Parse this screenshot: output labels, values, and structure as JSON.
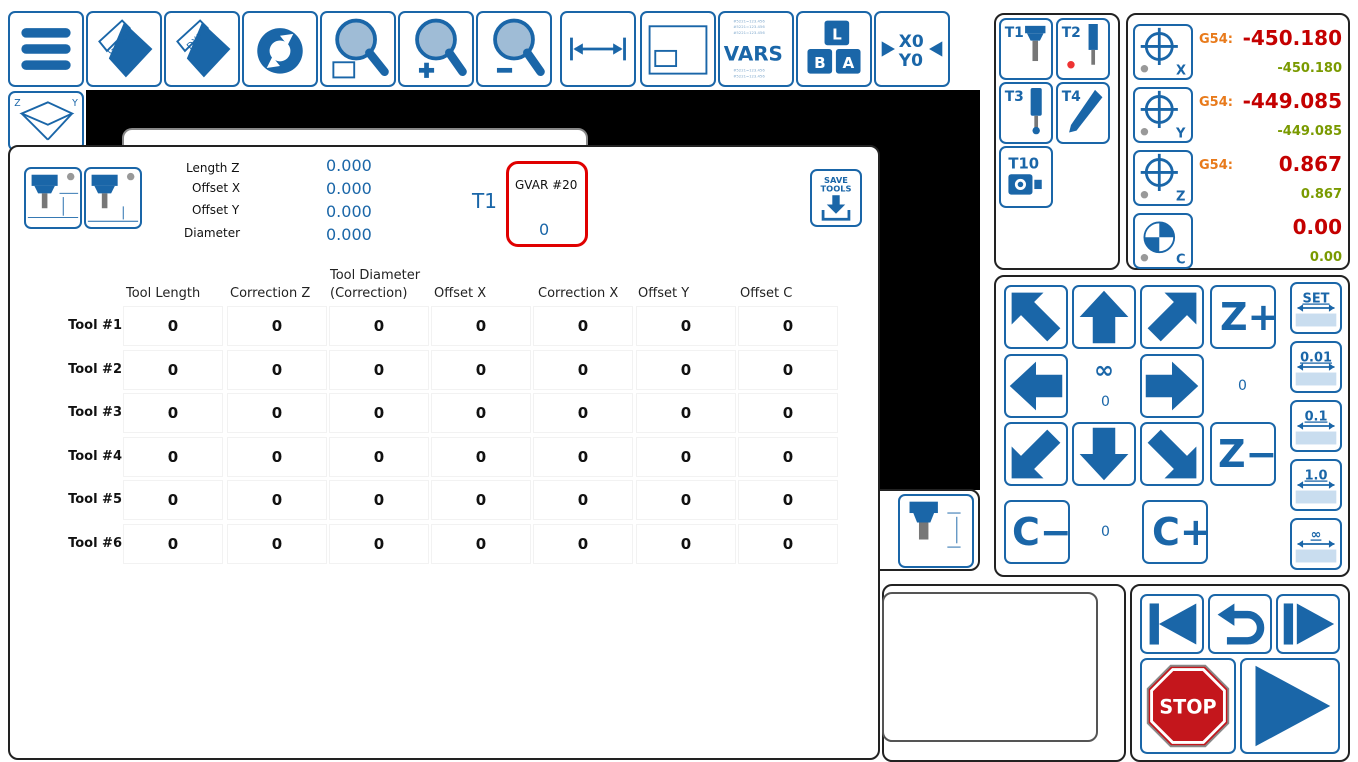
{
  "toolbar": {
    "gcode_label": "G-code",
    "dxf_label": "DXF",
    "vars_label": "VARS",
    "vars_fine": "#5221=123.456",
    "keys": [
      "L",
      "B",
      "A"
    ],
    "home_x": "X0",
    "home_y": "Y0"
  },
  "tool_panel": {
    "length_z_label": "Length Z",
    "length_z_value": "0.000",
    "offset_x_label": "Offset X",
    "offset_x_value": "0.000",
    "offset_y_label": "Offset Y",
    "offset_y_value": "0.000",
    "diameter_label": "Diameter",
    "diameter_value": "0.000",
    "tool_name": "T1",
    "gvar_label": "GVAR #20",
    "gvar_value": "0",
    "save_line1": "SAVE",
    "save_line2": "TOOLS"
  },
  "table": {
    "columns": [
      "Tool Length",
      "Correction Z",
      "Tool Diameter (Correction)",
      "Offset X",
      "Correction X",
      "Offset Y",
      "Offset C"
    ],
    "rows": [
      {
        "label": "Tool #1",
        "values": [
          "0",
          "0",
          "0",
          "0",
          "0",
          "0",
          "0"
        ]
      },
      {
        "label": "Tool #2",
        "values": [
          "0",
          "0",
          "0",
          "0",
          "0",
          "0",
          "0"
        ]
      },
      {
        "label": "Tool #3",
        "values": [
          "0",
          "0",
          "0",
          "0",
          "0",
          "0",
          "0"
        ]
      },
      {
        "label": "Tool #4",
        "values": [
          "0",
          "0",
          "0",
          "0",
          "0",
          "0",
          "0"
        ]
      },
      {
        "label": "Tool #5",
        "values": [
          "0",
          "0",
          "0",
          "0",
          "0",
          "0",
          "0"
        ]
      },
      {
        "label": "Tool #6",
        "values": [
          "0",
          "0",
          "0",
          "0",
          "0",
          "0",
          "0"
        ]
      }
    ]
  },
  "tools": [
    "T1",
    "T2",
    "T3",
    "T4",
    "T10"
  ],
  "coords": [
    {
      "axis": "X",
      "wcs": "G54:",
      "main": "-450.180",
      "sub": "-450.180"
    },
    {
      "axis": "Y",
      "wcs": "G54:",
      "main": "-449.085",
      "sub": "-449.085"
    },
    {
      "axis": "Z",
      "wcs": "G54:",
      "main": "0.867",
      "sub": "0.867"
    },
    {
      "axis": "C",
      "wcs": "",
      "main": "0.00",
      "sub": "0.00"
    }
  ],
  "jog": {
    "z_plus": "Z+",
    "z_minus": "Z−",
    "c_minus": "C−",
    "c_plus": "C+",
    "infinity": "∞",
    "xy_step": "0",
    "z_step": "0",
    "c_step": "0",
    "steps": [
      "SET",
      "0.01",
      "0.1",
      "1.0",
      "∞"
    ]
  },
  "run": {
    "stop_label": "STOP"
  },
  "colors": {
    "accent": "#1a66a8",
    "wcs": "#e87a1b",
    "coord_main": "#c40000",
    "coord_sub": "#7a9a00",
    "highlight": "#e00000",
    "stop": "#c4161c"
  }
}
